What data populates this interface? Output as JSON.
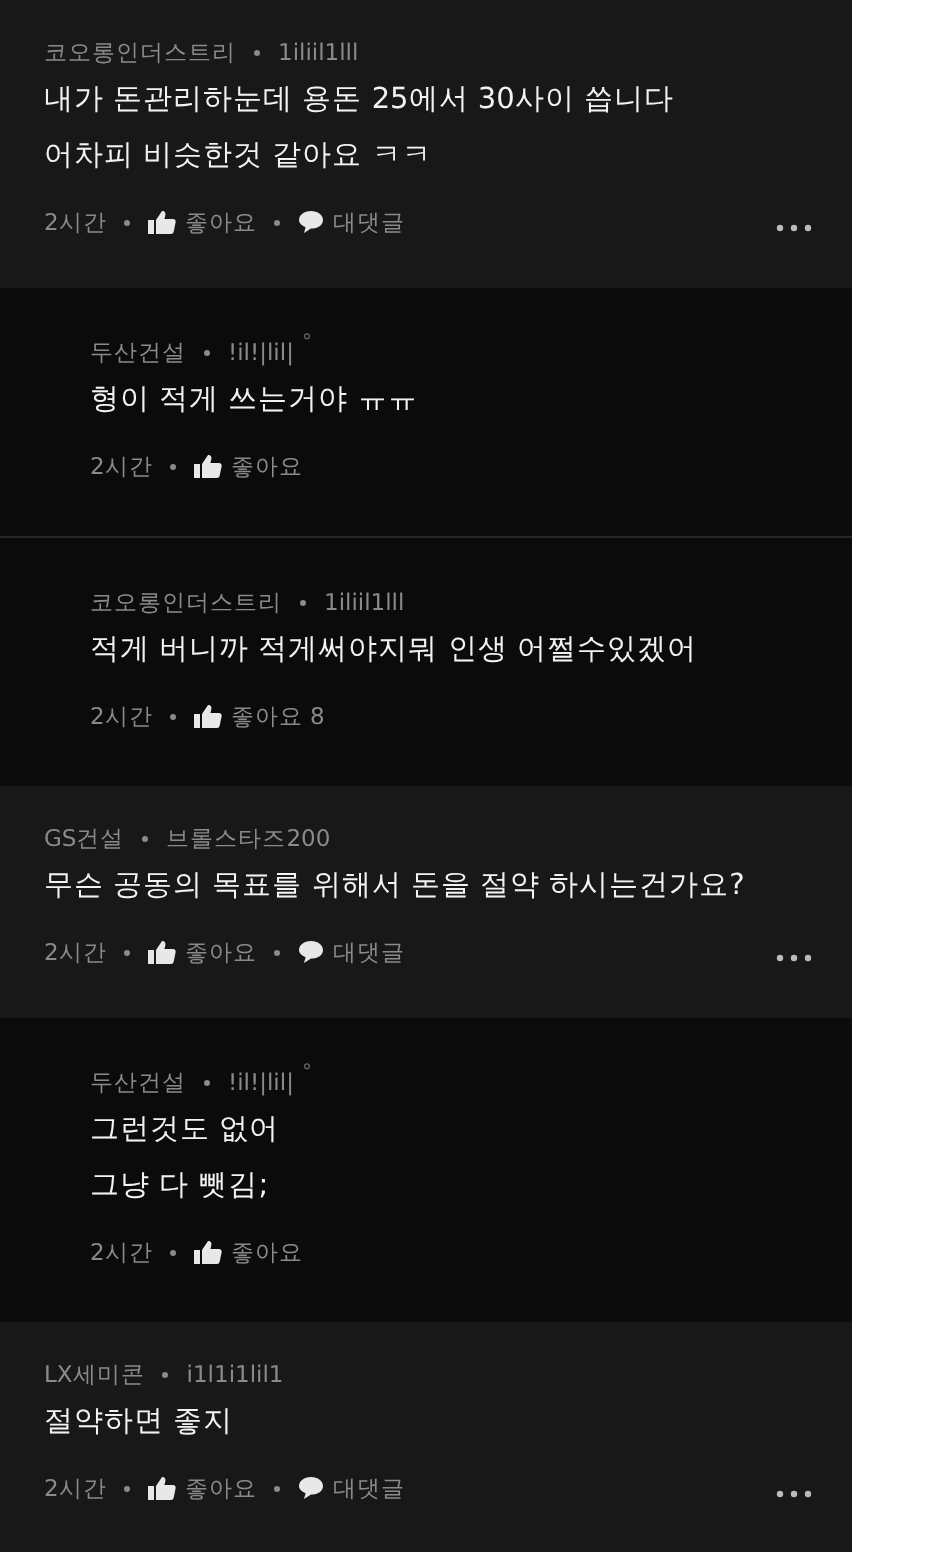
{
  "comments": [
    {
      "kind": "top",
      "author": "코오롱인더스트리",
      "handle": "1iliil1lll",
      "lines": [
        "내가 돈관리하눈데 용돈 25에서 30사이 씁니다",
        "어차피 비슷한것 같아요 ㅋㅋ"
      ],
      "time": "2시간",
      "like": "좋아요",
      "reply": "대댓글"
    },
    {
      "kind": "reply",
      "author": "두산건설",
      "handle": "!il!|lil|",
      "badge": "°",
      "lines": [
        "형이 적게 쓰는거야 ㅠㅠ"
      ],
      "time": "2시간",
      "like": "좋아요"
    },
    {
      "kind": "reply",
      "author": "코오롱인더스트리",
      "handle": "1iliil1lll",
      "lines": [
        "적게 버니까 적게써야지뭐 인생 어쩔수있겠어"
      ],
      "time": "2시간",
      "like": "좋아요 8"
    },
    {
      "kind": "top",
      "author": "GS건설",
      "handle": "브롤스타즈200",
      "lines": [
        "무슨 공동의 목표를 위해서 돈을 절약 하시는건가요?"
      ],
      "time": "2시간",
      "like": "좋아요",
      "reply": "대댓글"
    },
    {
      "kind": "reply",
      "author": "두산건설",
      "handle": "!il!|lil|",
      "badge": "°",
      "lines": [
        "그런것도 없어",
        "그냥 다 뺏김;"
      ],
      "time": "2시간",
      "like": "좋아요"
    },
    {
      "kind": "top",
      "author": "LX세미콘",
      "handle": "i1l1i1lil1",
      "lines": [
        "절약하면 좋지"
      ],
      "time": "2시간",
      "like": "좋아요",
      "reply": "대댓글"
    }
  ]
}
